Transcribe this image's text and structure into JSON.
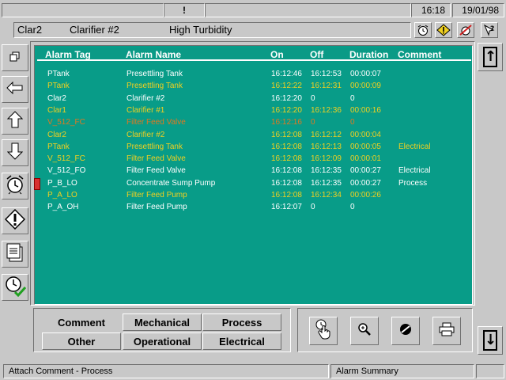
{
  "topbar": {
    "indicator": "!",
    "time": "16:18",
    "date": "19/01/98"
  },
  "header": {
    "tag": "Clar2",
    "name": "Clarifier #2",
    "description": "High Turbidity",
    "icons": [
      "alarm-clock-icon",
      "warning-icon",
      "alarm-silence-icon",
      "help-icon"
    ]
  },
  "left_toolbar": [
    "restore-window-icon",
    "back-arrow-icon",
    "arrow-up-icon",
    "arrow-down-icon",
    "alarm-clock-icon",
    "warning-icon",
    "notepad-icon",
    "alarm-acknowledge-icon"
  ],
  "table": {
    "columns": [
      "Alarm Tag",
      "Alarm Name",
      "On",
      "Off",
      "Duration",
      "Comment"
    ],
    "rows": [
      {
        "tag": "PTank",
        "name": "Presettling Tank",
        "on": "16:12:46",
        "off": "16:12:53",
        "duration": "00:00:07",
        "comment": "",
        "color": "#ffffff"
      },
      {
        "tag": "PTank",
        "name": "Presettling Tank",
        "on": "16:12:22",
        "off": "16:12:31",
        "duration": "00:00:09",
        "comment": "",
        "color": "#f0d020"
      },
      {
        "tag": "Clar2",
        "name": "Clarifier #2",
        "on": "16:12:20",
        "off": "0",
        "duration": "0",
        "comment": "",
        "color": "#ffffff"
      },
      {
        "tag": "Clar1",
        "name": "Clarifier #1",
        "on": "16:12:20",
        "off": "16:12:36",
        "duration": "00:00:16",
        "comment": "",
        "color": "#f0d020"
      },
      {
        "tag": "V_512_FC",
        "name": "Filter Feed Valve",
        "on": "16:12:16",
        "off": "0",
        "duration": "0",
        "comment": "",
        "color": "#e07820"
      },
      {
        "tag": "Clar2",
        "name": "Clarifier #2",
        "on": "16:12:08",
        "off": "16:12:12",
        "duration": "00:00:04",
        "comment": "",
        "color": "#f0d020"
      },
      {
        "tag": "PTank",
        "name": "Presettling Tank",
        "on": "16:12:08",
        "off": "16:12:13",
        "duration": "00:00:05",
        "comment": "Electrical",
        "color": "#f0d020"
      },
      {
        "tag": "V_512_FC",
        "name": "Filter Feed Valve",
        "on": "16:12:08",
        "off": "16:12:09",
        "duration": "00:00:01",
        "comment": "",
        "color": "#f0d020"
      },
      {
        "tag": "V_512_FO",
        "name": "Filter Feed Valve",
        "on": "16:12:08",
        "off": "16:12:35",
        "duration": "00:00:27",
        "comment": "Electrical",
        "color": "#ffffff"
      },
      {
        "tag": "P_B_LO",
        "name": "Concentrate Sump Pump",
        "on": "16:12:08",
        "off": "16:12:35",
        "duration": "00:00:27",
        "comment": "Process",
        "color": "#ffffff",
        "selected": true
      },
      {
        "tag": "P_A_LO",
        "name": "Filter Feed Pump",
        "on": "16:12:08",
        "off": "16:12:34",
        "duration": "00:00:26",
        "comment": "",
        "color": "#f0d020"
      },
      {
        "tag": "P_A_OH",
        "name": "Filter Feed Pump",
        "on": "16:12:07",
        "off": "0",
        "duration": "0",
        "comment": "",
        "color": "#ffffff"
      }
    ]
  },
  "right_toolbar": {
    "up_label": "↑",
    "down_label": "↓"
  },
  "filters": {
    "comment_label": "Comment",
    "mechanical": "Mechanical",
    "process": "Process",
    "other": "Other",
    "operational": "Operational",
    "electrical": "Electrical"
  },
  "actions": [
    "attach-comment-hand-icon",
    "zoom-icon",
    "mute-icon",
    "print-icon"
  ],
  "status": {
    "message": "Attach Comment - Process",
    "screen": "Alarm Summary"
  },
  "colors": {
    "grid_background": "#089c88",
    "active_alarm": "#f0d020",
    "cleared_alarm": "#ffffff",
    "unacked_alarm": "#e07820",
    "selection_marker": "#d83030"
  }
}
